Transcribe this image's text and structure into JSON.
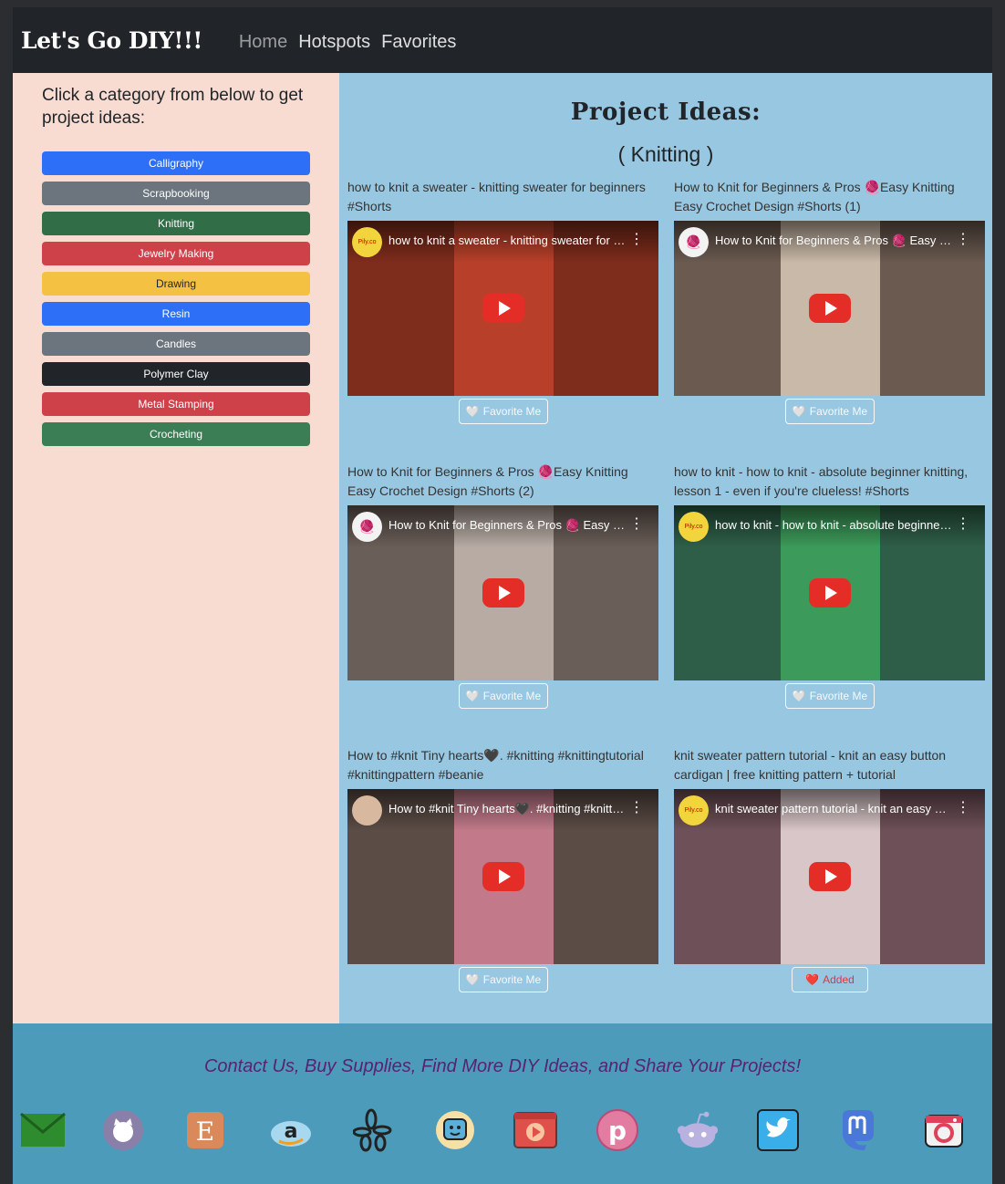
{
  "brand": "Let's Go DIY!!!",
  "nav": {
    "home": "Home",
    "hotspots": "Hotspots",
    "favorites": "Favorites"
  },
  "sidebar": {
    "title": "Click a category from below to get project ideas:",
    "categories": [
      {
        "label": "Calligraphy",
        "color": "#2d6ff6"
      },
      {
        "label": "Scrapbooking",
        "color": "#6c757d"
      },
      {
        "label": "Knitting",
        "color": "#316e48"
      },
      {
        "label": "Jewelry Making",
        "color": "#cf4149"
      },
      {
        "label": "Drawing",
        "color": "#f5c143"
      },
      {
        "label": "Resin",
        "color": "#2d6ff6"
      },
      {
        "label": "Candles",
        "color": "#6c757d"
      },
      {
        "label": "Polymer Clay",
        "color": "#212529"
      },
      {
        "label": "Metal Stamping",
        "color": "#cf4149"
      },
      {
        "label": "Crocheting",
        "color": "#3b7d55"
      }
    ]
  },
  "main": {
    "title": "Project Ideas:",
    "subtitle": "( Knitting )",
    "fav_label": "Favorite Me",
    "added_label": "Added",
    "videos": [
      {
        "title": "how to knit a sweater - knitting sweater for beginners #Shorts",
        "overlay": "how to knit a sweater - knitting sweater for beginners #Shorts",
        "channel": "Pily.co",
        "side": "#7e2c1c",
        "center": "#b8402a",
        "fav": "Favorite Me"
      },
      {
        "title": "How to Knit for Beginners & Pros 🧶Easy Knitting Easy Crochet Design #Shorts (1)",
        "overlay": "How to Knit for Beginners & Pros 🧶 Easy Knitting",
        "channel": "",
        "side": "#6a5a50",
        "center": "#c9b9a8",
        "fav": "Favorite Me"
      },
      {
        "title": "How to Knit for Beginners & Pros 🧶Easy Knitting Easy Crochet Design #Shorts (2)",
        "overlay": "How to Knit for Beginners & Pros 🧶 Easy Knitting",
        "channel": "",
        "side": "#6a5e58",
        "center": "#b8aba4",
        "fav": "Favorite Me"
      },
      {
        "title": "how to knit - how to knit - absolute beginner knitting, lesson 1 - even if you're clueless! #Shorts",
        "overlay": "how to knit - how to knit - absolute beginner knitting",
        "channel": "Pily.co",
        "side": "#2e5e48",
        "center": "#3c9a5a",
        "fav": "Favorite Me"
      },
      {
        "title": "How to #knit Tiny hearts🖤. #knitting #knittingtutorial #knittingpattern #beanie",
        "overlay": "How to #knit Tiny hearts🖤. #knitting #knittingtutorial",
        "channel": "",
        "side": "#5b4c46",
        "center": "#c27a8a",
        "fav": "Favorite Me"
      },
      {
        "title": "knit sweater pattern tutorial - knit an easy button cardigan | free knitting pattern + tutorial",
        "overlay": "knit sweater pattern tutorial - knit an easy button cardigan",
        "channel": "Pily.co",
        "side": "#6e5058",
        "center": "#d8c6c8",
        "fav": "Added"
      }
    ]
  },
  "footer": {
    "text": "Contact Us, Buy Supplies, Find More DIY Ideas, and Share Your Projects!",
    "icons": [
      "mail-icon",
      "github-icon",
      "etsy-icon",
      "amazon-icon",
      "yelp-icon",
      "waze-icon",
      "youtube-icon",
      "pinterest-icon",
      "reddit-icon",
      "twitter-icon",
      "mastodon-icon",
      "instagram-icon"
    ]
  }
}
